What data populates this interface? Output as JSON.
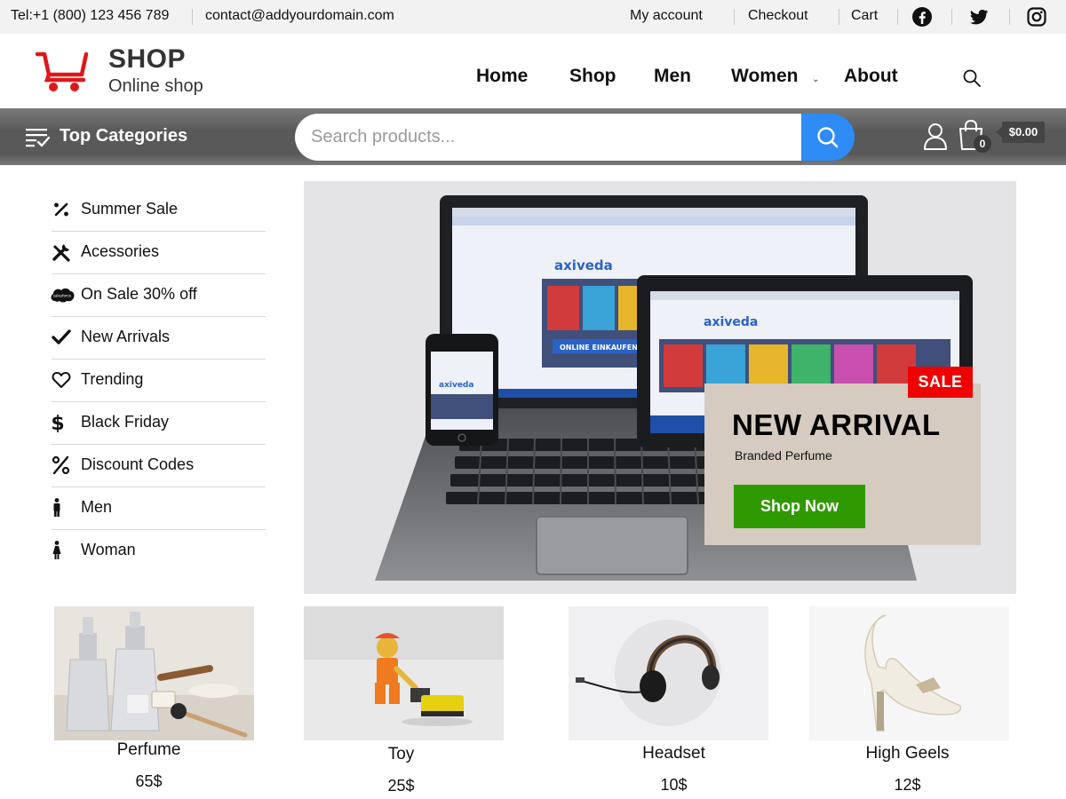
{
  "topbar": {
    "phone": "Tel:+1 (800) 123 456 789",
    "email": "contact@addyourdomain.com",
    "links": [
      "My account",
      "Checkout",
      "Cart"
    ],
    "social_icons": [
      "facebook-icon",
      "twitter-icon",
      "instagram-icon"
    ]
  },
  "brand": {
    "name": "SHOP",
    "tagline": "Online shop",
    "logo_color": "#e0161b"
  },
  "nav": {
    "items": [
      "Home",
      "Shop",
      "Men",
      "Women",
      "About"
    ],
    "search_icon": "search-icon"
  },
  "category_bar": {
    "label": "Top Categories",
    "search_placeholder": "Search products...",
    "search_button_color": "#2f8bf5",
    "cart_count": "0",
    "cart_total": "$0.00"
  },
  "sidebar": {
    "items": [
      {
        "label": "Summer Sale",
        "icon": "percent-tag-icon"
      },
      {
        "label": "Acessories",
        "icon": "tools-icon"
      },
      {
        "label": "On Sale 30% off",
        "icon": "salesforce-cloud-icon"
      },
      {
        "label": "New Arrivals",
        "icon": "check-icon"
      },
      {
        "label": "Trending",
        "icon": "heart-icon"
      },
      {
        "label": "Black Friday",
        "icon": "dollar-icon"
      },
      {
        "label": "Discount Codes",
        "icon": "percent-icon"
      },
      {
        "label": "Men",
        "icon": "male-icon"
      },
      {
        "label": "Woman",
        "icon": "female-icon"
      }
    ]
  },
  "hero": {
    "badge": "SALE",
    "title": "NEW ARRIVAL",
    "subtitle": "Branded Perfume",
    "button": "Shop Now",
    "badge_color": "#f00000",
    "button_color": "#2f9900",
    "screen_brand": "axiveda",
    "screen_tagline": "ONLINE EINKAUFEN"
  },
  "products": [
    {
      "name": "Perfume",
      "price": "65$"
    },
    {
      "name": "Toy",
      "price": "25$"
    },
    {
      "name": "Headset",
      "price": "10$"
    },
    {
      "name": "High Geels",
      "price": "12$"
    }
  ]
}
